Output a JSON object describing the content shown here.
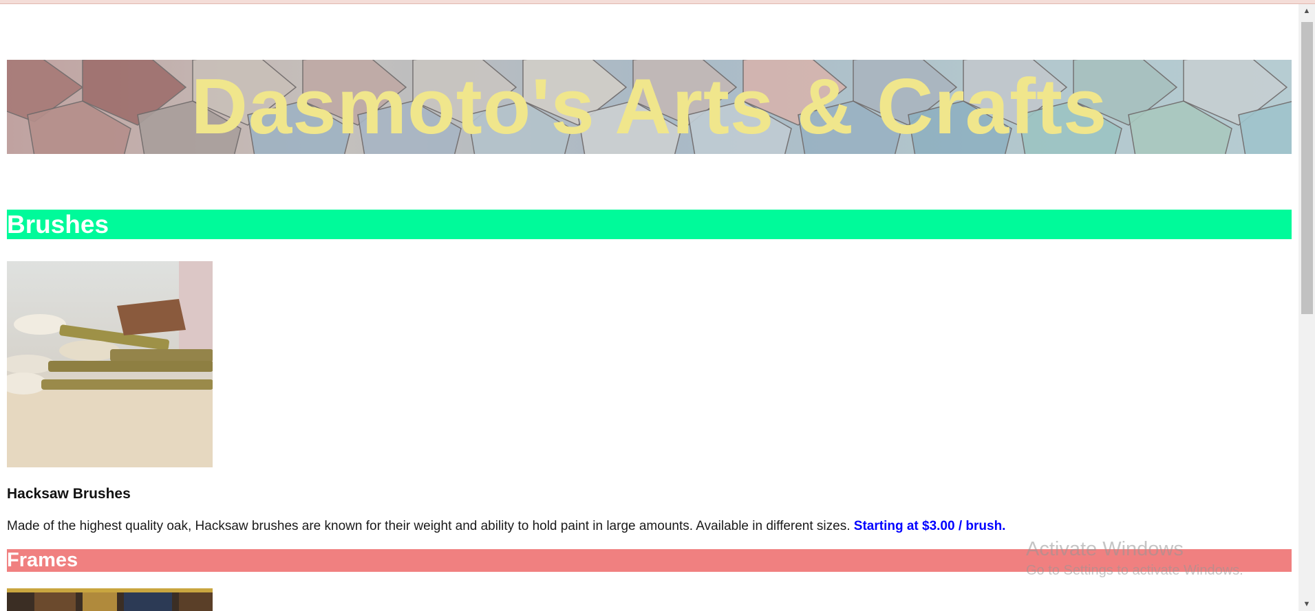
{
  "banner": {
    "title": "Dasmoto's Arts & Crafts"
  },
  "sections": {
    "brushes": {
      "heading": "Brushes",
      "product_name": "Hacksaw Brushes",
      "description": "Made of the highest quality oak, Hacksaw brushes are known for their weight and ability to hold paint in large amounts. Available in different sizes. ",
      "price": "Starting at $3.00 / brush."
    },
    "frames": {
      "heading": "Frames"
    }
  },
  "watermark": {
    "title": "Activate Windows",
    "subtitle": "Go to Settings to activate Windows."
  },
  "scrollbar": {
    "up_icon": "scroll-up-arrow-icon",
    "down_icon": "scroll-down-arrow-icon"
  },
  "colors": {
    "banner_text": "#f0e68c",
    "brushes_bar": "#00fa9a",
    "frames_bar": "#f08080",
    "price_text": "#0000ff"
  }
}
